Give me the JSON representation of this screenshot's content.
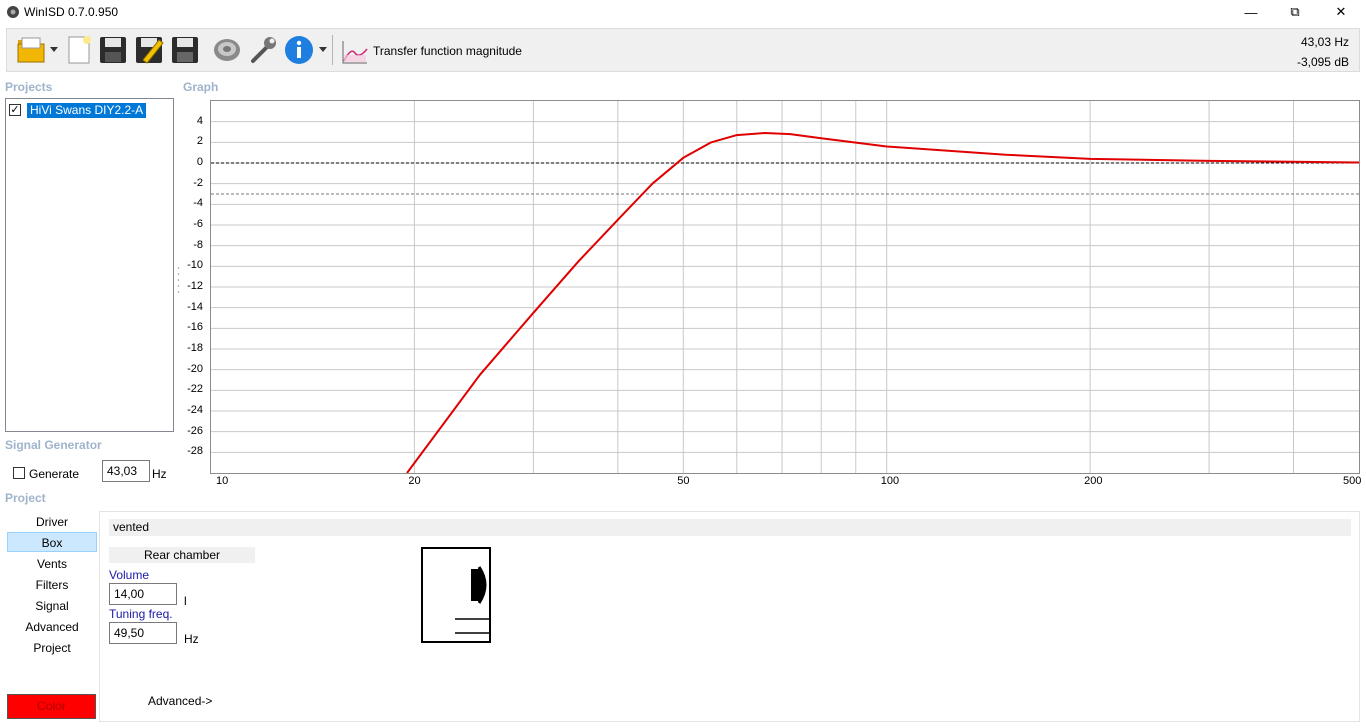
{
  "window": {
    "title": "WinISD 0.7.0.950",
    "minimize": "—",
    "restore": "⧉",
    "close": "✕"
  },
  "toolbar": {
    "transfer_label": "Transfer function magnitude"
  },
  "readout": {
    "frequency": "43,03 Hz",
    "level": "-3,095 dB"
  },
  "sections": {
    "projects": "Projects",
    "graph": "Graph",
    "signal_generator": "Signal Generator",
    "project": "Project"
  },
  "projects": [
    {
      "name": "HiVi Swans DIY2.2-A",
      "checked": "✓"
    }
  ],
  "signal_generator": {
    "generate_label": "Generate",
    "frequency_value": "43,03",
    "unit": "Hz"
  },
  "nav": {
    "items": [
      "Driver",
      "Box",
      "Vents",
      "Filters",
      "Signal",
      "Advanced",
      "Project"
    ],
    "selected": "Box"
  },
  "color_button": {
    "label": "Color",
    "color": "#ff0000"
  },
  "box_panel": {
    "box_type": "vented",
    "rear_chamber": "Rear chamber",
    "volume_label": "Volume",
    "volume_value": "14,00",
    "volume_unit": "l",
    "tuning_label": "Tuning freq.",
    "tuning_value": "49,50",
    "tuning_unit": "Hz",
    "advanced_link": "Advanced->"
  },
  "chart_data": {
    "type": "line",
    "x_scale": "log",
    "xlim": [
      10,
      500
    ],
    "ylim": [
      -30,
      6
    ],
    "x_ticks": [
      10,
      20,
      50,
      100,
      200,
      500
    ],
    "y_ticks": [
      4,
      2,
      0,
      -2,
      -4,
      -6,
      -8,
      -10,
      -12,
      -14,
      -16,
      -18,
      -20,
      -22,
      -24,
      -26,
      -28
    ],
    "reference_lines": [
      0,
      -3
    ],
    "grid": true,
    "series": [
      {
        "color": "#e00000",
        "x": [
          19.5,
          25,
          30,
          35,
          40,
          45,
          50,
          55,
          60,
          66,
          72,
          80,
          100,
          150,
          200,
          300,
          500
        ],
        "y": [
          -30,
          -20.5,
          -14.5,
          -9.5,
          -5.5,
          -2.0,
          0.5,
          2.0,
          2.7,
          2.9,
          2.8,
          2.4,
          1.6,
          0.8,
          0.4,
          0.2,
          0.05
        ]
      }
    ]
  }
}
